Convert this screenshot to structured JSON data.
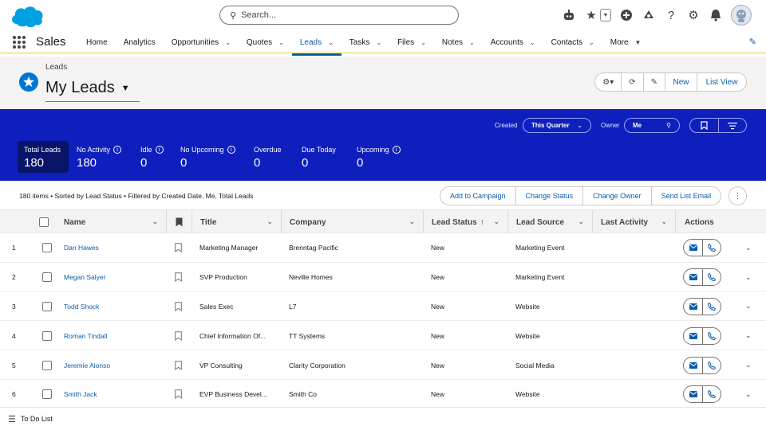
{
  "global_header": {
    "search_placeholder": "Search..."
  },
  "nav": {
    "app_name": "Sales",
    "items": [
      {
        "label": "Home",
        "dropdown": false,
        "active": false
      },
      {
        "label": "Analytics",
        "dropdown": false,
        "active": false
      },
      {
        "label": "Opportunities",
        "dropdown": true,
        "active": false
      },
      {
        "label": "Quotes",
        "dropdown": true,
        "active": false
      },
      {
        "label": "Leads",
        "dropdown": true,
        "active": true
      },
      {
        "label": "Tasks",
        "dropdown": true,
        "active": false
      },
      {
        "label": "Files",
        "dropdown": true,
        "active": false
      },
      {
        "label": "Notes",
        "dropdown": true,
        "active": false
      },
      {
        "label": "Accounts",
        "dropdown": true,
        "active": false
      },
      {
        "label": "Contacts",
        "dropdown": true,
        "active": false
      },
      {
        "label": "More",
        "dropdown": true,
        "active": false
      }
    ]
  },
  "page_header": {
    "breadcrumb": "Leads",
    "title": "My Leads",
    "new_label": "New",
    "list_view_label": "List View"
  },
  "filters": {
    "created_label": "Created",
    "created_value": "This Quarter",
    "owner_label": "Owner",
    "owner_value": "Me"
  },
  "metrics": [
    {
      "label": "Total Leads",
      "value": "180",
      "info": false,
      "selected": true
    },
    {
      "label": "No Activity",
      "value": "180",
      "info": true,
      "selected": false
    },
    {
      "label": "Idle",
      "value": "0",
      "info": true,
      "selected": false
    },
    {
      "label": "No Upcoming",
      "value": "0",
      "info": true,
      "selected": false
    },
    {
      "label": "Overdue",
      "value": "0",
      "info": false,
      "selected": false
    },
    {
      "label": "Due Today",
      "value": "0",
      "info": false,
      "selected": false
    },
    {
      "label": "Upcoming",
      "value": "0",
      "info": true,
      "selected": false
    }
  ],
  "list_info": {
    "summary": "180 items • Sorted by Lead Status • Filtered by Created Date, Me, Total Leads",
    "actions": [
      "Add to Campaign",
      "Change Status",
      "Change Owner",
      "Send List Email"
    ]
  },
  "table": {
    "columns": {
      "name": "Name",
      "title": "Title",
      "company": "Company",
      "lead_status": "Lead Status",
      "lead_source": "Lead Source",
      "last_activity": "Last Activity",
      "actions": "Actions"
    },
    "rows": [
      {
        "num": "1",
        "name": "Dan Hawes",
        "title": "Marketing Manager",
        "company": "Brenntag Pacific",
        "status": "New",
        "source": "Marketing Event",
        "last_activity": ""
      },
      {
        "num": "2",
        "name": "Megan Salyer",
        "title": "SVP Production",
        "company": "Neville Homes",
        "status": "New",
        "source": "Marketing Event",
        "last_activity": ""
      },
      {
        "num": "3",
        "name": "Todd Shock",
        "title": "Sales Exec",
        "company": "L7",
        "status": "New",
        "source": "Website",
        "last_activity": ""
      },
      {
        "num": "4",
        "name": "Roman Tindall",
        "title": "Chief Information Of...",
        "company": "TT Systems",
        "status": "New",
        "source": "Website",
        "last_activity": ""
      },
      {
        "num": "5",
        "name": "Jeremie Alonso",
        "title": "VP Consulting",
        "company": "Clarity Corporation",
        "status": "New",
        "source": "Social Media",
        "last_activity": ""
      },
      {
        "num": "6",
        "name": "Smith Jack",
        "title": "EVP Business Devel...",
        "company": "Smith Co",
        "status": "New",
        "source": "Website",
        "last_activity": ""
      }
    ]
  },
  "footer": {
    "todo_label": "To Do List"
  },
  "colors": {
    "brand_blue": "#0176d3",
    "link_blue": "#0b5cab",
    "band_blue": "#0e1fbd",
    "selected_metric": "#071468"
  }
}
